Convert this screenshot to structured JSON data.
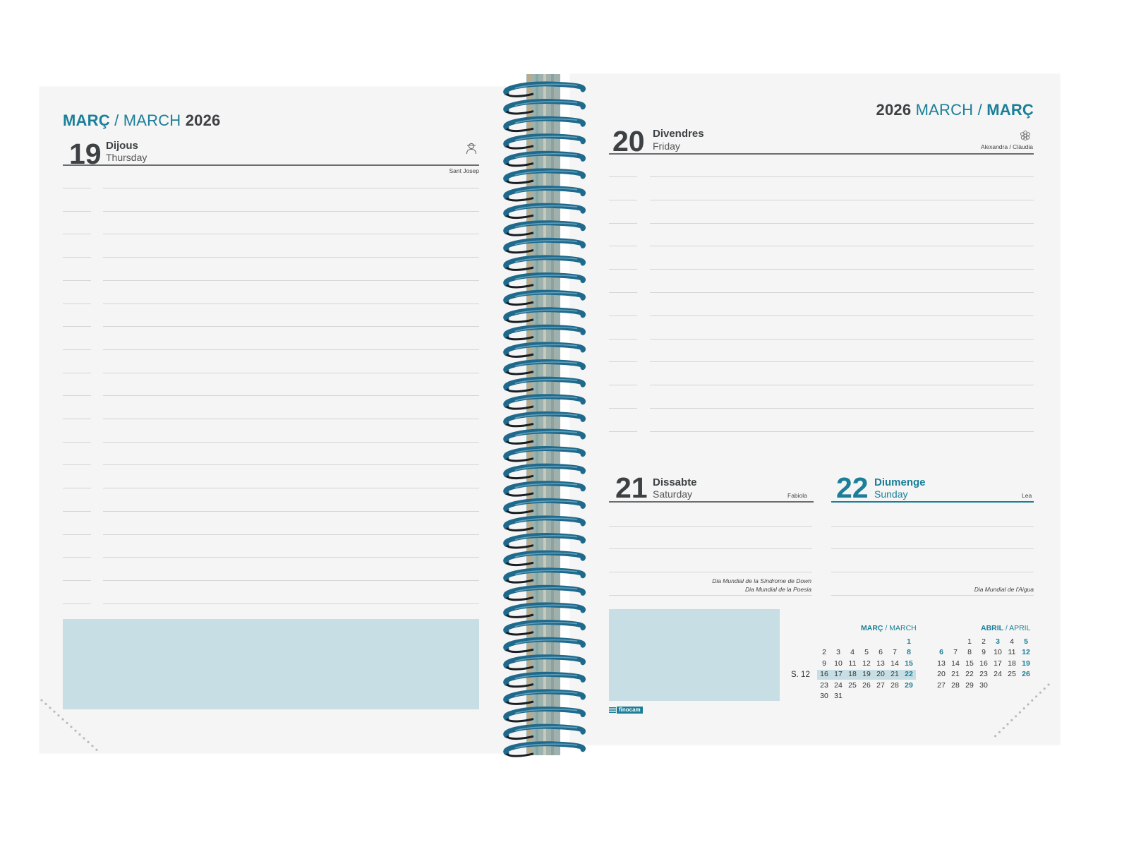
{
  "left_page": {
    "header": {
      "month_ca": "MARÇ",
      "separator": "/",
      "month_en": "MARCH",
      "year": "2026"
    },
    "day": {
      "number": "19",
      "name_ca": "Dijous",
      "name_en": "Thursday",
      "saint": "Sant Josep",
      "icon": "person-icon"
    }
  },
  "right_page": {
    "header": {
      "year": "2026",
      "month_en": "MARCH",
      "separator": "/",
      "month_ca": "MARÇ"
    },
    "friday": {
      "number": "20",
      "name_ca": "Divendres",
      "name_en": "Friday",
      "saint": "Alexandra / Clàudia",
      "icon": "flower-icon"
    },
    "saturday": {
      "number": "21",
      "name_ca": "Dissabte",
      "name_en": "Saturday",
      "saint": "Fabiola",
      "notes": [
        "Dia Mundial de la Síndrome de Down",
        "Dia Mundial de la Poesia"
      ]
    },
    "sunday": {
      "number": "22",
      "name_ca": "Diumenge",
      "name_en": "Sunday",
      "saint": "Lea",
      "notes": [
        "Dia Mundial de l'Aigua"
      ]
    },
    "brand": "finocam",
    "week_label": "S. 12",
    "mini_calendars": [
      {
        "title_ca": "MARÇ",
        "title_en": "/ MARCH",
        "weeks": [
          [
            "",
            "",
            "",
            "",
            "",
            "",
            "1"
          ],
          [
            "2",
            "3",
            "4",
            "5",
            "6",
            "7",
            "8"
          ],
          [
            "9",
            "10",
            "11",
            "12",
            "13",
            "14",
            "15"
          ],
          [
            "16",
            "17",
            "18",
            "19",
            "20",
            "21",
            "22"
          ],
          [
            "23",
            "24",
            "25",
            "26",
            "27",
            "28",
            "29"
          ],
          [
            "30",
            "31",
            "",
            "",
            "",
            "",
            ""
          ]
        ],
        "highlight_week": 3
      },
      {
        "title_ca": "ABRIL",
        "title_en": "/ APRIL",
        "weeks": [
          [
            "",
            "",
            "1",
            "2",
            "3",
            "4",
            "5"
          ],
          [
            "6",
            "7",
            "8",
            "9",
            "10",
            "11",
            "12"
          ],
          [
            "13",
            "14",
            "15",
            "16",
            "17",
            "18",
            "19"
          ],
          [
            "20",
            "21",
            "22",
            "23",
            "24",
            "25",
            "26"
          ],
          [
            "27",
            "28",
            "29",
            "30",
            "",
            "",
            ""
          ]
        ],
        "holidays": [
          "3",
          "6"
        ]
      }
    ]
  },
  "colors": {
    "accent": "#1b7f99",
    "text_dark": "#3e4143",
    "note_box": "#c7dfe4",
    "spiral": "#1f6a8c",
    "paper": "#f4f5f4"
  }
}
